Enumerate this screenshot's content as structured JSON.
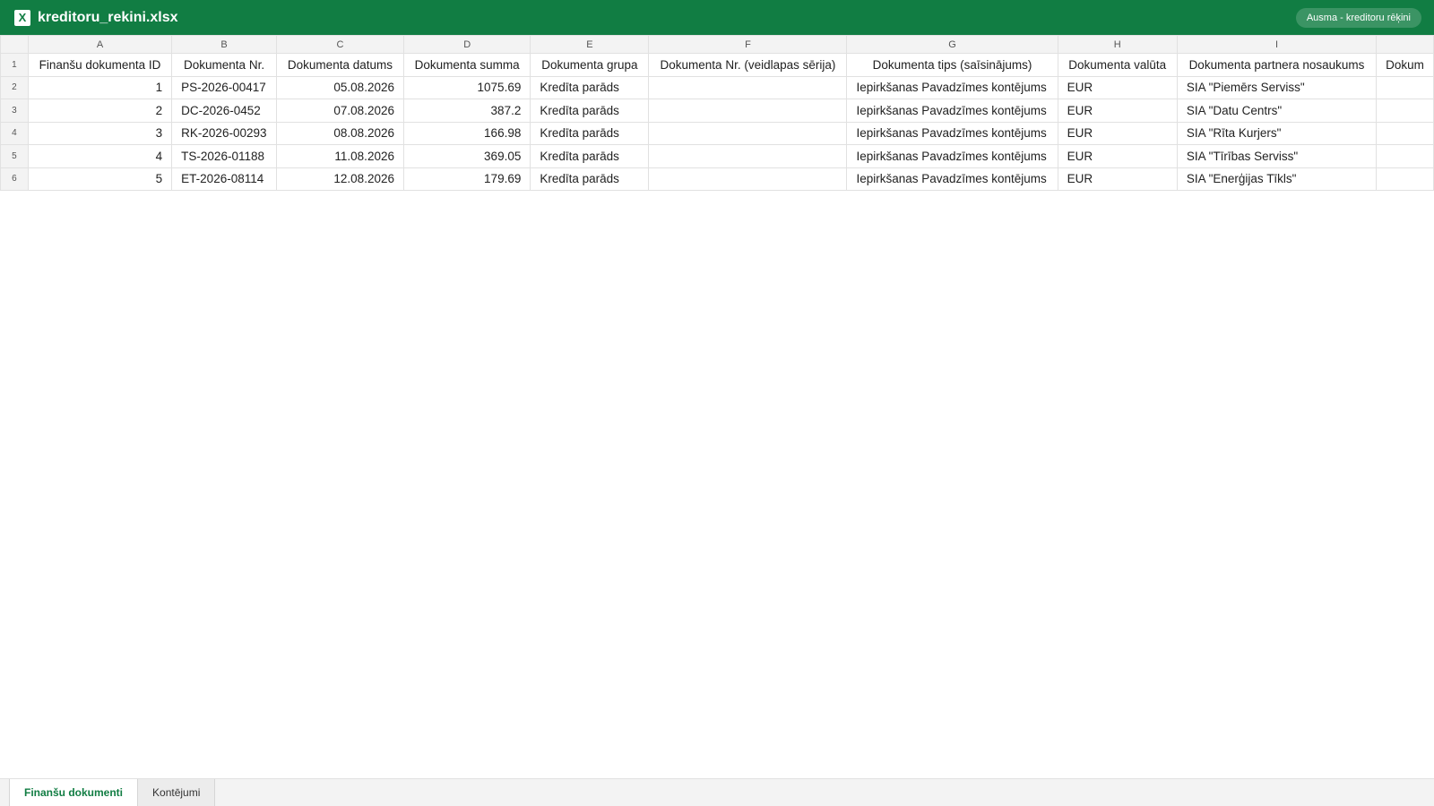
{
  "app": {
    "icon": "excel-icon",
    "icon_glyph": "X",
    "filename": "kreditoru_rekini.xlsx",
    "profile_badge": "Ausma - kreditoru rēķini",
    "accent_color": "#117d43"
  },
  "sheet": {
    "column_letters": [
      "A",
      "B",
      "C",
      "D",
      "E",
      "F",
      "G",
      "H",
      "I",
      ""
    ],
    "header_row_number": "1",
    "headers": [
      "Finanšu dokumenta ID",
      "Dokumenta Nr.",
      "Dokumenta datums",
      "Dokumenta summa",
      "Dokumenta grupa",
      "Dokumenta Nr. (veidlapas sērija)",
      "Dokumenta tips (saīsinājums)",
      "Dokumenta valūta",
      "Dokumenta partnera nosaukums",
      "Dokum"
    ],
    "rows": [
      {
        "num": "2",
        "cells": [
          "1",
          "PS-2026-00417",
          "05.08.2026",
          "1075.69",
          "Kredīta parāds",
          "",
          "Iepirkšanas Pavadzīmes kontējums",
          "EUR",
          "SIA \"Piemērs Serviss\"",
          ""
        ]
      },
      {
        "num": "3",
        "cells": [
          "2",
          "DC-2026-0452",
          "07.08.2026",
          "387.2",
          "Kredīta parāds",
          "",
          "Iepirkšanas Pavadzīmes kontējums",
          "EUR",
          "SIA \"Datu Centrs\"",
          ""
        ]
      },
      {
        "num": "4",
        "cells": [
          "3",
          "RK-2026-00293",
          "08.08.2026",
          "166.98",
          "Kredīta parāds",
          "",
          "Iepirkšanas Pavadzīmes kontējums",
          "EUR",
          "SIA \"Rīta Kurjers\"",
          ""
        ]
      },
      {
        "num": "5",
        "cells": [
          "4",
          "TS-2026-01188",
          "11.08.2026",
          "369.05",
          "Kredīta parāds",
          "",
          "Iepirkšanas Pavadzīmes kontējums",
          "EUR",
          "SIA \"Tīrības Serviss\"",
          ""
        ]
      },
      {
        "num": "6",
        "cells": [
          "5",
          "ET-2026-08114",
          "12.08.2026",
          "179.69",
          "Kredīta parāds",
          "",
          "Iepirkšanas Pavadzīmes kontējums",
          "EUR",
          "SIA \"Enerģijas Tīkls\"",
          ""
        ]
      }
    ]
  },
  "tabs": [
    {
      "label": "Finanšu dokumenti",
      "active": true
    },
    {
      "label": "Kontējumi",
      "active": false
    }
  ]
}
